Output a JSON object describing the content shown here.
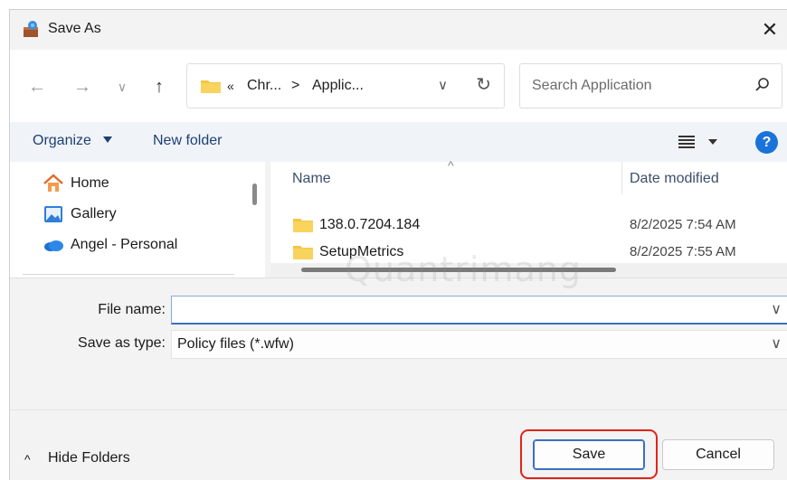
{
  "window": {
    "title": "Save As"
  },
  "address": {
    "segments": [
      "Chr...",
      "Applic..."
    ],
    "overflow_marker": "«",
    "separator": ">"
  },
  "search": {
    "placeholder": "Search Application"
  },
  "toolbar": {
    "organize_label": "Organize",
    "new_folder_label": "New folder",
    "help_label": "?"
  },
  "nav_pane": {
    "items": [
      {
        "label": "Home",
        "icon": "home-icon"
      },
      {
        "label": "Gallery",
        "icon": "gallery-icon"
      },
      {
        "label": "Angel - Personal",
        "icon": "onedrive-cloud-icon"
      }
    ]
  },
  "file_list": {
    "columns": [
      "Name",
      "Date modified"
    ],
    "rows": [
      {
        "name": "138.0.7204.184",
        "date": "8/2/2025 7:54 AM"
      },
      {
        "name": "SetupMetrics",
        "date": "8/2/2025 7:55 AM"
      }
    ]
  },
  "form": {
    "file_name_label": "File name:",
    "file_name_value": "",
    "save_type_label": "Save as type:",
    "save_type_value": "Policy files (*.wfw)"
  },
  "footer": {
    "hide_folders_label": "Hide Folders",
    "save_label": "Save",
    "cancel_label": "Cancel"
  },
  "watermark": "Quantrimang",
  "colors": {
    "accent": "#1a73d9",
    "highlight": "#e2231a",
    "folder": "#f4c542"
  }
}
